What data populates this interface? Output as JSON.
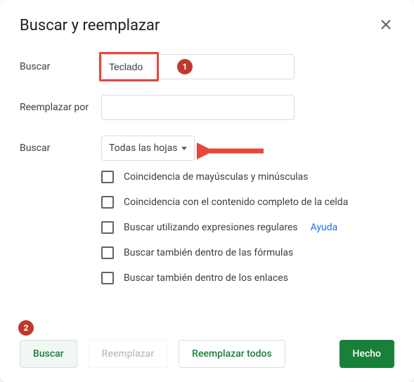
{
  "dialog": {
    "title": "Buscar y reemplazar",
    "search_label": "Buscar",
    "search_value": "Teclado",
    "replace_label": "Reemplazar por",
    "replace_value": "",
    "scope_label": "Buscar",
    "scope_value": "Todas las hojas",
    "checks": [
      "Coincidencia de mayúsculas y minúsculas",
      "Coincidencia con el contenido completo de la celda",
      "Buscar utilizando expresiones regulares",
      "Buscar también dentro de las fórmulas",
      "Buscar también dentro de los enlaces"
    ],
    "help_link": "Ayuda",
    "buttons": {
      "find": "Buscar",
      "replace": "Reemplazar",
      "replace_all": "Reemplazar todos",
      "done": "Hecho"
    }
  },
  "annotations": {
    "badge1": "1",
    "badge2": "2"
  }
}
